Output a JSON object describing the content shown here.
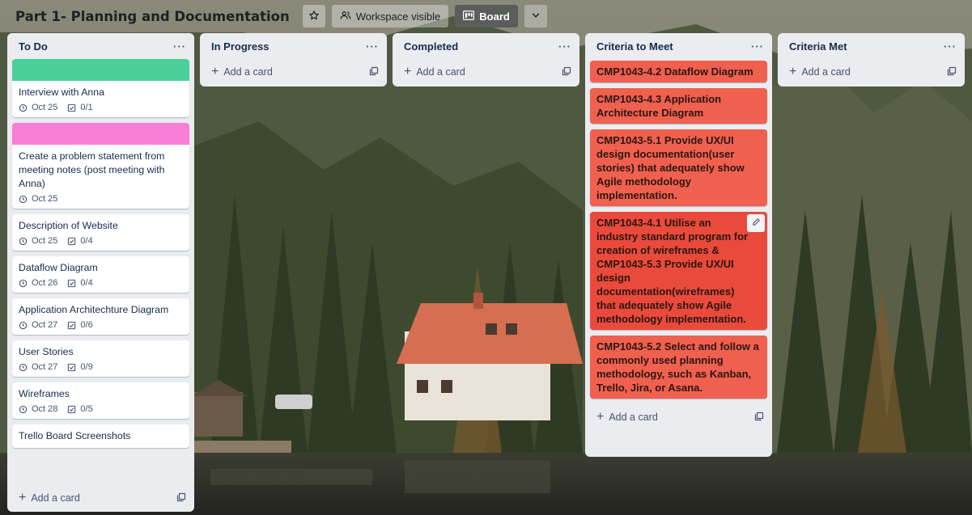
{
  "board": {
    "title": "Part 1- Planning and Documentation",
    "visibility_label": "Workspace visible",
    "view_label": "Board",
    "star_icon": "star-icon",
    "visibility_icon": "people-icon",
    "view_icon": "board-icon",
    "dropdown_icon": "chevron-down-icon"
  },
  "lists": {
    "todo": {
      "title": "To Do",
      "menu": "···",
      "add_label": "Add a card",
      "cards": [
        {
          "title": "Interview with Anna",
          "date": "Oct 25",
          "checklist": "0/1",
          "cover": "#4bce97"
        },
        {
          "title": "Create a problem statement from meeting notes (post meeting with Anna)",
          "date": "Oct 25",
          "cover": "#f87ed7"
        },
        {
          "title": "Description of Website",
          "date": "Oct 25",
          "checklist": "0/4"
        },
        {
          "title": "Dataflow Diagram",
          "date": "Oct 26",
          "checklist": "0/4"
        },
        {
          "title": "Application Architechture Diagram",
          "date": "Oct 27",
          "checklist": "0/6"
        },
        {
          "title": "User Stories",
          "date": "Oct 27",
          "checklist": "0/9"
        },
        {
          "title": "Wireframes",
          "date": "Oct 28",
          "checklist": "0/5"
        },
        {
          "title": "Trello Board Screenshots"
        }
      ]
    },
    "in_progress": {
      "title": "In Progress",
      "menu": "···",
      "add_label": "Add a card"
    },
    "completed": {
      "title": "Completed",
      "menu": "···",
      "add_label": "Add a card"
    },
    "criteria_to_meet": {
      "title": "Criteria to Meet",
      "menu": "···",
      "add_label": "Add a card",
      "card_color": "#f0604f",
      "cards": [
        {
          "title": "CMP1043-4.2 Dataflow Diagram"
        },
        {
          "title": "CMP1043-4.3 Application Architecture Diagram"
        },
        {
          "title": "CMP1043-5.1 Provide UX/UI design documentation(user stories) that adequately show Agile methodology implementation."
        },
        {
          "title": "CMP1043-4.1 Utilise an industry standard program for creation of wireframes & CMP1043-5.3 Provide UX/UI design documentation(wireframes) that adequately show Agile methodology implementation."
        },
        {
          "title": "CMP1043-5.2 Select and follow a commonly used planning methodology, such as Kanban, Trello, Jira, or Asana."
        }
      ]
    },
    "criteria_met": {
      "title": "Criteria Met",
      "menu": "···",
      "add_label": "Add a card"
    }
  }
}
